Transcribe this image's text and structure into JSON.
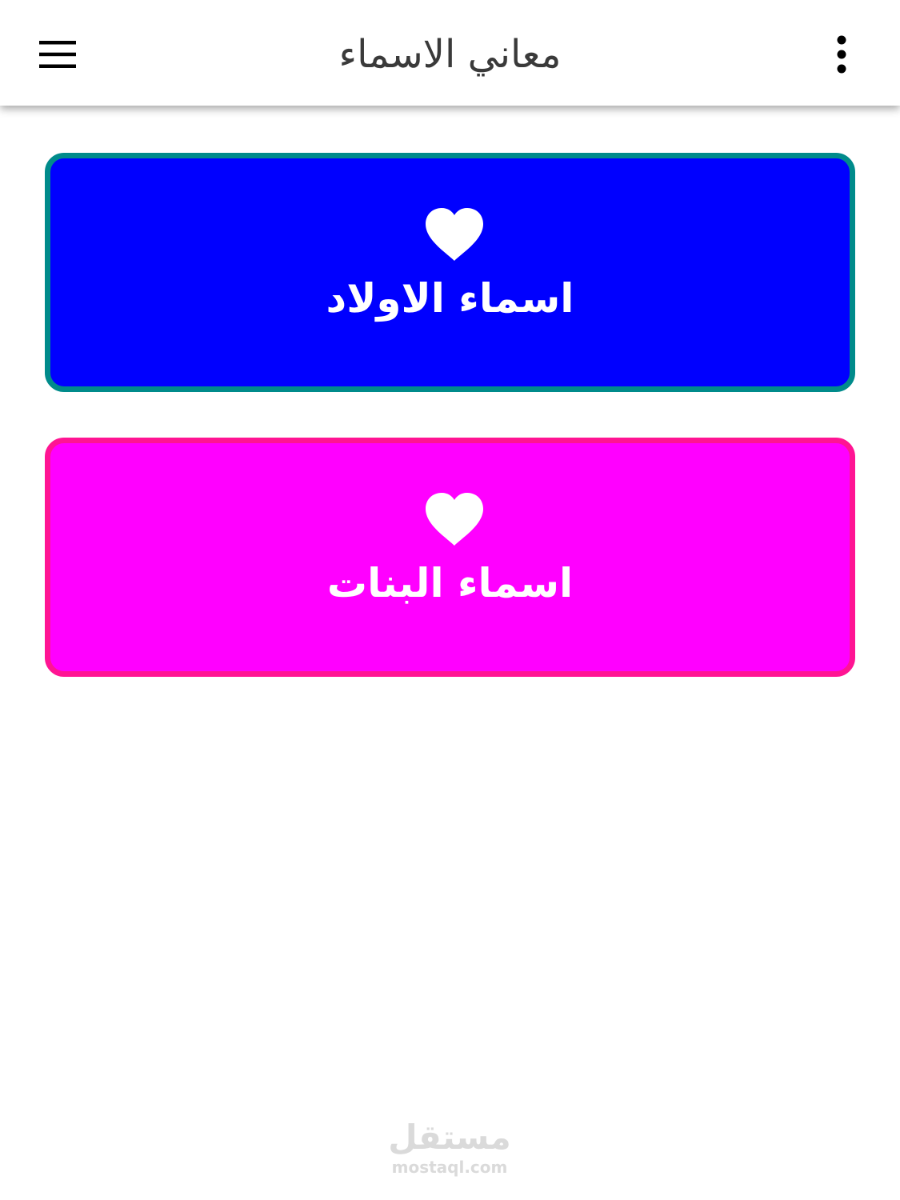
{
  "app_bar": {
    "title": "معاني الاسماء",
    "menu_icon": "hamburger-menu-icon",
    "more_icon": "more-vertical-icon"
  },
  "cards": [
    {
      "label": "اسماء الاولاد",
      "icon": "heart-icon",
      "background": "#0000ff",
      "border": "#008b8b"
    },
    {
      "label": "اسماء البنات",
      "icon": "heart-icon",
      "background": "#ff00ff",
      "border": "#ff1493"
    }
  ],
  "watermark": {
    "logo_text": "مستقل",
    "url": "mostaql.com"
  }
}
